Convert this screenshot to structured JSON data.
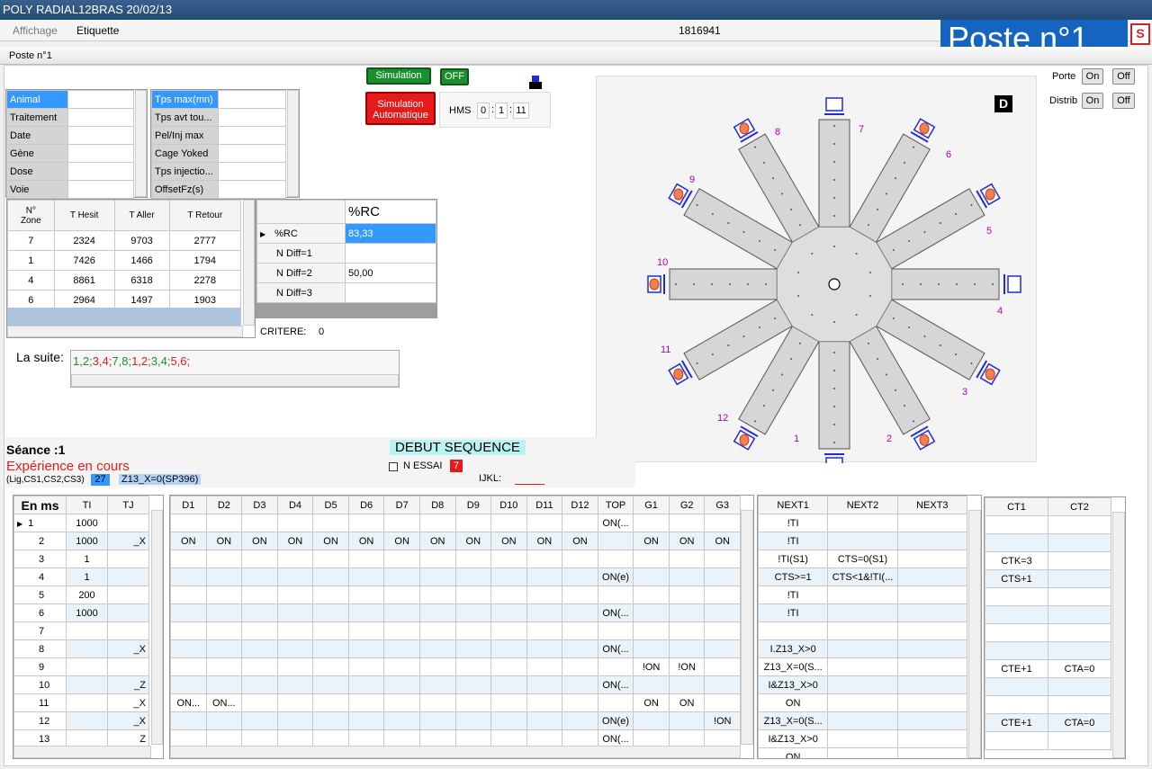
{
  "window": {
    "title": "POLY RADIAL12BRAS 20/02/13",
    "menu": [
      "Affichage",
      "Etiquette"
    ],
    "id": "1816941",
    "poste_banner": "Poste n°1",
    "s_button": "S",
    "tab": "Poste n°1"
  },
  "props_left": [
    {
      "label": "Animal",
      "value": ""
    },
    {
      "label": "Traitement",
      "value": ""
    },
    {
      "label": "Date",
      "value": ""
    },
    {
      "label": "Gène",
      "value": ""
    },
    {
      "label": "Dose",
      "value": ""
    },
    {
      "label": "Voie",
      "value": ""
    }
  ],
  "props_right": [
    {
      "label": "Tps max(mn)",
      "value": ""
    },
    {
      "label": "Tps avt tou...",
      "value": ""
    },
    {
      "label": "Pel/Inj max",
      "value": ""
    },
    {
      "label": "Cage Yoked",
      "value": ""
    },
    {
      "label": "Tps injectio...",
      "value": ""
    },
    {
      "label": "OffsetFz(s)",
      "value": ""
    }
  ],
  "sim": {
    "simulation_label": "Simulation",
    "off_label": "OFF",
    "auto_label_1": "Simulation",
    "auto_label_2": "Automatique",
    "hms_label": "HMS",
    "h": "0",
    "m": "1",
    "s": "11"
  },
  "zones": {
    "headers": [
      "N°\nZone",
      "T Hesit",
      "T Aller",
      "T Retour"
    ],
    "rows": [
      [
        "7",
        "2324",
        "9703",
        "2777"
      ],
      [
        "1",
        "7426",
        "1466",
        "1794"
      ],
      [
        "4",
        "8861",
        "6318",
        "2278"
      ],
      [
        "6",
        "2964",
        "1497",
        "1903"
      ]
    ]
  },
  "rc": {
    "header": "%RC",
    "rows": [
      {
        "label": "%RC",
        "value": "83,33"
      },
      {
        "label": "N Diff=1",
        "value": ""
      },
      {
        "label": "N Diff=2",
        "value": "50,00"
      },
      {
        "label": "N Diff=3",
        "value": ""
      }
    ],
    "critere_label": "CRITERE:",
    "critere_value": "0"
  },
  "suite": {
    "label": "La suite:",
    "items": [
      {
        "t": "1,2;",
        "c": "#1a8f2e"
      },
      {
        "t": "3,4;",
        "c": "#e51a1a"
      },
      {
        "t": "7,8;",
        "c": "#1a8f2e"
      },
      {
        "t": "1,2;",
        "c": "#e51a1a"
      },
      {
        "t": "3,4;",
        "c": "#1a8f2e"
      },
      {
        "t": "5,6;",
        "c": "#e51a1a"
      }
    ]
  },
  "porte": {
    "label": "Porte",
    "on": "On",
    "off": "Off"
  },
  "distrib": {
    "label": "Distrib",
    "on": "On",
    "off": "Off"
  },
  "radial": {
    "d_label": "D",
    "arm_numbers": [
      "1",
      "2",
      "3",
      "4",
      "5",
      "6",
      "7",
      "8",
      "9",
      "10",
      "11",
      "12"
    ]
  },
  "seance": {
    "label": "Séance :1",
    "experience": "Expérience en cours",
    "lig": "(Lig,CS1,CS2,CS3)",
    "badge": "27",
    "z13": "Z13_X=0(SP396)"
  },
  "debut": "DEBUT SEQUENCE",
  "nessai": {
    "label": "N ESSAI",
    "value": "7"
  },
  "ijkl": "IJKL:",
  "colors": {
    "title_bar": "#2c5282",
    "accent": "#3399ff",
    "banner": "#1565c0",
    "on_green": "#1a8f2e",
    "alarm_red": "#e51a1a"
  },
  "seq": {
    "headers_a": [
      "En ms",
      "TI",
      "TJ"
    ],
    "headers_b": [
      "D1",
      "D2",
      "D3",
      "D4",
      "D5",
      "D6",
      "D7",
      "D8",
      "D9",
      "D10",
      "D11",
      "D12",
      "TOP",
      "G1",
      "G2",
      "G3"
    ],
    "headers_c": [
      "NEXT1",
      "NEXT2",
      "NEXT3"
    ],
    "headers_d": [
      "CT1",
      "CT2"
    ],
    "rows": [
      {
        "n": "1",
        "ti": "1000",
        "tj": "",
        "d": [
          "",
          "",
          "",
          "",
          "",
          "",
          "",
          "",
          "",
          "",
          "",
          "",
          "ON(...",
          "",
          "",
          ""
        ],
        "nx": [
          "!TI",
          "",
          ""
        ],
        "ct": [
          "",
          ""
        ]
      },
      {
        "n": "2",
        "ti": "1000",
        "tj": "_X",
        "d": [
          "ON",
          "ON",
          "ON",
          "ON",
          "ON",
          "ON",
          "ON",
          "ON",
          "ON",
          "ON",
          "ON",
          "ON",
          "",
          "ON",
          "ON",
          "ON"
        ],
        "nx": [
          "!TI",
          "",
          ""
        ],
        "ct": [
          "",
          ""
        ]
      },
      {
        "n": "3",
        "ti": "1",
        "tj": "",
        "d": [
          "",
          "",
          "",
          "",
          "",
          "",
          "",
          "",
          "",
          "",
          "",
          "",
          "",
          "",
          "",
          ""
        ],
        "nx": [
          "!TI(S1)",
          "CTS=0(S1)",
          ""
        ],
        "ct": [
          "CTK=3",
          ""
        ]
      },
      {
        "n": "4",
        "ti": "1",
        "tj": "",
        "d": [
          "",
          "",
          "",
          "",
          "",
          "",
          "",
          "",
          "",
          "",
          "",
          "",
          "ON(e)",
          "",
          "",
          ""
        ],
        "nx": [
          "CTS>=1",
          "CTS<1&!TI(...",
          ""
        ],
        "ct": [
          "CTS+1",
          ""
        ]
      },
      {
        "n": "5",
        "ti": "200",
        "tj": "",
        "d": [
          "",
          "",
          "",
          "",
          "",
          "",
          "",
          "",
          "",
          "",
          "",
          "",
          "",
          "",
          "",
          ""
        ],
        "nx": [
          "!TI",
          "",
          ""
        ],
        "ct": [
          "",
          ""
        ]
      },
      {
        "n": "6",
        "ti": "1000",
        "tj": "",
        "d": [
          "",
          "",
          "",
          "",
          "",
          "",
          "",
          "",
          "",
          "",
          "",
          "",
          "ON(...",
          "",
          "",
          ""
        ],
        "nx": [
          "!TI",
          "",
          ""
        ],
        "ct": [
          "",
          ""
        ]
      },
      {
        "n": "7",
        "ti": "",
        "tj": "",
        "d": [
          "",
          "",
          "",
          "",
          "",
          "",
          "",
          "",
          "",
          "",
          "",
          "",
          "",
          "",
          "",
          ""
        ],
        "nx": [
          "",
          "",
          ""
        ],
        "ct": [
          "",
          ""
        ]
      },
      {
        "n": "8",
        "ti": "",
        "tj": "_X",
        "d": [
          "",
          "",
          "",
          "",
          "",
          "",
          "",
          "",
          "",
          "",
          "",
          "",
          "ON(...",
          "",
          "",
          ""
        ],
        "nx": [
          "I.Z13_X>0",
          "",
          ""
        ],
        "ct": [
          "",
          ""
        ]
      },
      {
        "n": "9",
        "ti": "",
        "tj": "",
        "d": [
          "",
          "",
          "",
          "",
          "",
          "",
          "",
          "",
          "",
          "",
          "",
          "",
          "",
          "!ON",
          "!ON",
          ""
        ],
        "nx": [
          "Z13_X=0(S...",
          "",
          ""
        ],
        "ct": [
          "CTE+1",
          "CTA=0"
        ]
      },
      {
        "n": "10",
        "ti": "",
        "tj": "_Z",
        "d": [
          "",
          "",
          "",
          "",
          "",
          "",
          "",
          "",
          "",
          "",
          "",
          "",
          "ON(...",
          "",
          "",
          ""
        ],
        "nx": [
          "I&Z13_X>0",
          "",
          ""
        ],
        "ct": [
          "",
          ""
        ]
      },
      {
        "n": "11",
        "ti": "",
        "tj": "_X",
        "d": [
          "ON...",
          "ON...",
          "",
          "",
          "",
          "",
          "",
          "",
          "",
          "",
          "",
          "",
          "",
          "ON",
          "ON",
          ""
        ],
        "nx": [
          "ON",
          "",
          ""
        ],
        "ct": [
          "",
          ""
        ]
      },
      {
        "n": "12",
        "ti": "",
        "tj": "_X",
        "d": [
          "",
          "",
          "",
          "",
          "",
          "",
          "",
          "",
          "",
          "",
          "",
          "",
          "ON(e)",
          "",
          "",
          "!ON"
        ],
        "nx": [
          "Z13_X=0(S...",
          "",
          ""
        ],
        "ct": [
          "CTE+1",
          "CTA=0"
        ]
      },
      {
        "n": "13",
        "ti": "",
        "tj": "Z",
        "d": [
          "",
          "",
          "",
          "",
          "",
          "",
          "",
          "",
          "",
          "",
          "",
          "",
          "ON(...",
          "",
          "",
          ""
        ],
        "nx": [
          "I&Z13_X>0",
          "",
          ""
        ],
        "ct": [
          "",
          ""
        ]
      }
    ],
    "extra_next": "ON"
  }
}
